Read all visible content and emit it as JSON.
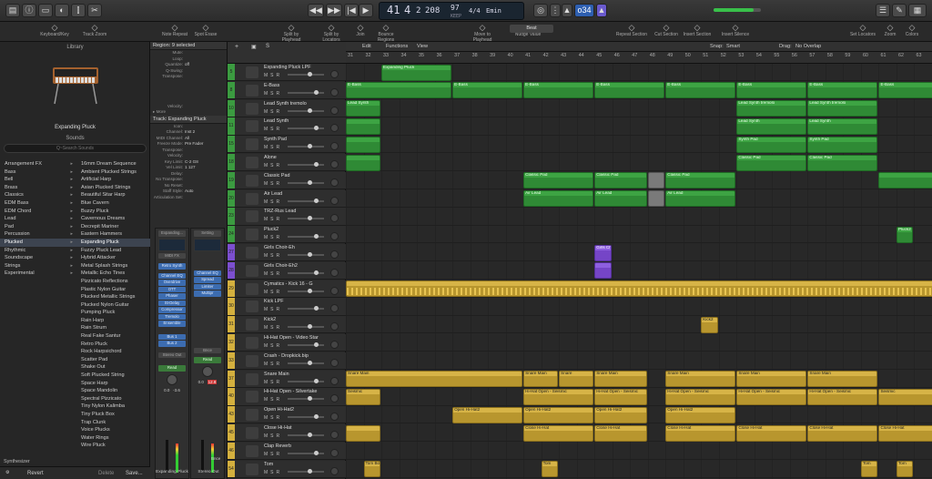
{
  "transport": {
    "bars": "41",
    "beats": "4",
    "division": "2",
    "ticks": "208",
    "tempo": "97",
    "tempo_label": "KEEP",
    "sig": "4/4",
    "key": "Emin",
    "cpu_label": "o34"
  },
  "toolbar": {
    "items": [
      "Keyboard/Key",
      "Track Zoom",
      "Note Repeat",
      "Spot Erase",
      "Split by Playhead",
      "Split by Locators",
      "Join",
      "Bounce Regions",
      "Move to Playhead",
      "Nudge Value",
      "Repeat Section",
      "Cut Section",
      "Insert Section",
      "Insert Silence",
      "Set Locators",
      "Zoom",
      "Colors"
    ],
    "beat_label": "Beat"
  },
  "library": {
    "title": "Library",
    "patch_name": "Expanding Pluck",
    "sounds_label": "Sounds",
    "search_placeholder": "Q~Search Sounds",
    "categories": [
      "Arrangement FX",
      "Bass",
      "Bell",
      "Brass",
      "Classics",
      "EDM Bass",
      "EDM Chord",
      "Lead",
      "Pad",
      "Percussion",
      "Plucked",
      "Rhythmic",
      "Soundscape",
      "Strings",
      "Experimental"
    ],
    "selected_category": "Plucked",
    "patches": [
      "16mm Dream Sequence",
      "Ambient Plucked Strings",
      "Artificial Harp",
      "Asian Plucked Strings",
      "Beautiful Sitar Harp",
      "Blue Cavern",
      "Buzzy Pluck",
      "Cavernous Dreams",
      "Decrepit Mariner",
      "Eastern Hammers",
      "Expanding Pluck",
      "Fuzzy Pluck Lead",
      "Hybrid Attacker",
      "Metal Splash Strings",
      "Metallic Echo Tines",
      "Pizzicato Reflections",
      "Plastic Nylon Guitar",
      "Plucked Metallic Strings",
      "Plucked Nylon Guitar",
      "Pumping Pluck",
      "Rain Harp",
      "Rain Strum",
      "Real Fake Santur",
      "Retro Pluck",
      "Rock Harpsichord",
      "Scatter Pad",
      "Shake Out",
      "Soft Plucked String",
      "Space Harp",
      "Space Mandolin",
      "Spectral Pizzicato",
      "Tiny Nylon Kalimba",
      "Tiny Pluck Box",
      "Trap Clunk",
      "Voice Plucks",
      "Water Rings",
      "Wire Pluck"
    ],
    "selected_patch": "Expanding Pluck",
    "footer": {
      "category": "Synthesizer",
      "revert": "Revert",
      "delete": "Delete",
      "save": "Save..."
    }
  },
  "inspector": {
    "region_header": "Region: 9 selected",
    "region_params": [
      [
        "Mute:",
        ""
      ],
      [
        "Loop:",
        ""
      ],
      [
        "Quantize:",
        "off"
      ],
      [
        "Q-Swing:",
        ""
      ],
      [
        "Transpose:",
        ""
      ],
      [
        "",
        ""
      ],
      [
        "",
        ""
      ],
      [
        "",
        ""
      ],
      [
        "",
        ""
      ],
      [
        "Velocity:",
        ""
      ]
    ],
    "more": "More",
    "track_header": "Track: Expanding Pluck",
    "track_params": [
      [
        "Icon:",
        ""
      ],
      [
        "Channel:",
        "Inst 2"
      ],
      [
        "MIDI Channel:",
        "All"
      ],
      [
        "Freeze Mode:",
        "Pre Fader"
      ],
      [
        "Transpose:",
        ""
      ],
      [
        "Velocity:",
        ""
      ],
      [
        "Key Limit:",
        "C-2 G8"
      ],
      [
        "Vel Limit:",
        "1 127"
      ],
      [
        "Delay:",
        ""
      ],
      [
        "No Transpose:",
        ""
      ],
      [
        "No Reset:",
        ""
      ],
      [
        "Staff Style:",
        "Auto"
      ],
      [
        "Articulation Set:",
        ""
      ]
    ],
    "strip1": {
      "setting": "Expanding...",
      "eq": "",
      "midi_fx": "MIDI FX",
      "instrument": "Retro Synth",
      "plugins": [
        "Channel EQ",
        "Overdrive",
        "OTT",
        "Phaser",
        "St-Delay",
        "Compressor",
        "Tremolo",
        "Ensemble"
      ],
      "sends": [
        "Bus 1",
        "Bus 2"
      ],
      "output": "Stereo Out",
      "mode": "Read",
      "vol": "0.0",
      "pan": "-3.6",
      "name": "Expanding Pluck"
    },
    "strip2": {
      "setting": "Setting",
      "plugins": [
        "Channel EQ",
        "Spread",
        "Limiter",
        "Multipr"
      ],
      "output": "Bnce",
      "mode": "Read",
      "vol": "0.0",
      "pan": "12.8",
      "name": "Stereo Out",
      "bnce": "Bnce"
    }
  },
  "arrange": {
    "menus": [
      "Edit",
      "Functions",
      "View"
    ],
    "snap_label": "Snap:",
    "snap_value": "Smart",
    "drag_label": "Drag:",
    "drag_value": "No Overlap",
    "bars": [
      "31",
      "32",
      "33",
      "34",
      "35",
      "36",
      "37",
      "38",
      "39",
      "40",
      "41",
      "42",
      "43",
      "44",
      "45",
      "46",
      "47",
      "48",
      "49",
      "50",
      "51",
      "52",
      "53",
      "54",
      "55",
      "56",
      "57",
      "58",
      "59",
      "60",
      "61",
      "62",
      "63"
    ]
  },
  "tracks": [
    {
      "n": "5",
      "name": "Expanding Pluck LPF",
      "c": "#3b9b40"
    },
    {
      "n": "8",
      "name": "E-Bass",
      "c": "#3b9b40"
    },
    {
      "n": "10",
      "name": "Lead Synth tremolo",
      "c": "#3b9b40"
    },
    {
      "n": "11",
      "name": "Lead Synth",
      "c": "#3b9b40"
    },
    {
      "n": "15",
      "name": "Synth Pad",
      "c": "#3b9b40"
    },
    {
      "n": "18",
      "name": "Alone",
      "c": "#3b9b40"
    },
    {
      "n": "19",
      "name": "Classic Pad",
      "c": "#3b9b40"
    },
    {
      "n": "20",
      "name": "Air Lead",
      "c": "#3b9b40"
    },
    {
      "n": "23",
      "name": "TRZ-Rus Lead",
      "c": "#3b9b40"
    },
    {
      "n": "24",
      "name": "Pluck2",
      "c": "#3b9b40"
    },
    {
      "n": "27",
      "name": "Girls Choir-Eh",
      "c": "#7c4fd0"
    },
    {
      "n": "28",
      "name": "Girls Choir-Eh2",
      "c": "#7c4fd0"
    },
    {
      "n": "29",
      "name": "Cymatics - Kick 16 - G",
      "c": "#d4b03e"
    },
    {
      "n": "30",
      "name": "Kick LPF",
      "c": "#d4b03e"
    },
    {
      "n": "31",
      "name": "Kick2",
      "c": "#d4b03e"
    },
    {
      "n": "32",
      "name": "Hi-Hat Open - Video Star",
      "c": "#d4b03e"
    },
    {
      "n": "33",
      "name": "Crash - Dropkick.bip",
      "c": "#d4b03e"
    },
    {
      "n": "37",
      "name": "Snare Main",
      "c": "#d4b03e"
    },
    {
      "n": "40",
      "name": "Hi-Hat Open - Silvertake",
      "c": "#d4b03e"
    },
    {
      "n": "43",
      "name": "Open Hi-Hat2",
      "c": "#d4b03e"
    },
    {
      "n": "45",
      "name": "Close Hi-Hat",
      "c": "#d4b03e"
    },
    {
      "n": "46",
      "name": "Clap Reverb",
      "c": "#d4b03e"
    },
    {
      "n": "54",
      "name": "Tom",
      "c": "#d4b03e"
    }
  ],
  "regions": [
    {
      "lane": 0,
      "b": 2,
      "e": 6,
      "t": "g",
      "l": "Expanding Pluck"
    },
    {
      "lane": 1,
      "b": 0,
      "e": 6,
      "t": "g",
      "l": "E-Bass"
    },
    {
      "lane": 1,
      "b": 6,
      "e": 10,
      "t": "g",
      "l": "E-Bass"
    },
    {
      "lane": 1,
      "b": 10,
      "e": 14,
      "t": "g",
      "l": "E-Bass"
    },
    {
      "lane": 1,
      "b": 14,
      "e": 18,
      "t": "g",
      "l": "E-Bass"
    },
    {
      "lane": 1,
      "b": 18,
      "e": 22,
      "t": "g",
      "l": "E-Bass"
    },
    {
      "lane": 1,
      "b": 22,
      "e": 26,
      "t": "g",
      "l": "E-Bass"
    },
    {
      "lane": 1,
      "b": 26,
      "e": 30,
      "t": "g",
      "l": "E-Bass"
    },
    {
      "lane": 1,
      "b": 30,
      "e": 34,
      "t": "g",
      "l": "E-Bass"
    },
    {
      "lane": 2,
      "b": 0,
      "e": 2,
      "t": "g",
      "l": "Lead Synth"
    },
    {
      "lane": 2,
      "b": 22,
      "e": 26,
      "t": "g",
      "l": "Lead Synth tremolo"
    },
    {
      "lane": 2,
      "b": 26,
      "e": 30,
      "t": "g",
      "l": "Lead Synth tremolo"
    },
    {
      "lane": 3,
      "b": 0,
      "e": 2,
      "t": "g",
      "l": ""
    },
    {
      "lane": 3,
      "b": 22,
      "e": 26,
      "t": "g",
      "l": "Lead Synth"
    },
    {
      "lane": 3,
      "b": 26,
      "e": 30,
      "t": "g",
      "l": "Lead Synth"
    },
    {
      "lane": 4,
      "b": 0,
      "e": 2,
      "t": "g",
      "l": ""
    },
    {
      "lane": 4,
      "b": 22,
      "e": 26,
      "t": "g",
      "l": "Synth Pad"
    },
    {
      "lane": 4,
      "b": 26,
      "e": 30,
      "t": "g",
      "l": "Synth Pad"
    },
    {
      "lane": 5,
      "b": 0,
      "e": 2,
      "t": "g",
      "l": ""
    },
    {
      "lane": 5,
      "b": 22,
      "e": 26,
      "t": "g",
      "l": "Classic Pad"
    },
    {
      "lane": 5,
      "b": 26,
      "e": 30,
      "t": "g",
      "l": "Classic Pad"
    },
    {
      "lane": 6,
      "b": 10,
      "e": 14,
      "t": "g",
      "l": "Classic Pad"
    },
    {
      "lane": 6,
      "b": 14,
      "e": 17,
      "t": "g",
      "l": "Classic Pad"
    },
    {
      "lane": 6,
      "b": 17,
      "e": 18,
      "t": "gr",
      "l": ""
    },
    {
      "lane": 6,
      "b": 18,
      "e": 22,
      "t": "g",
      "l": "Classic Pad"
    },
    {
      "lane": 6,
      "b": 30,
      "e": 34,
      "t": "g",
      "l": ""
    },
    {
      "lane": 7,
      "b": 10,
      "e": 14,
      "t": "g",
      "l": "Air Lead"
    },
    {
      "lane": 7,
      "b": 14,
      "e": 17,
      "t": "g",
      "l": "Air Lead"
    },
    {
      "lane": 7,
      "b": 17,
      "e": 18,
      "t": "gr",
      "l": ""
    },
    {
      "lane": 7,
      "b": 18,
      "e": 22,
      "t": "g",
      "l": "Air Lead"
    },
    {
      "lane": 9,
      "b": 31,
      "e": 32,
      "t": "g",
      "l": "Pluck2"
    },
    {
      "lane": 10,
      "b": 14,
      "e": 15,
      "t": "p",
      "l": "Girls Ch"
    },
    {
      "lane": 11,
      "b": 14,
      "e": 15,
      "t": "p",
      "l": ""
    },
    {
      "lane": 12,
      "b": 0,
      "e": 34,
      "t": "yt",
      "l": ""
    },
    {
      "lane": 14,
      "b": 20,
      "e": 21,
      "t": "y",
      "l": "Kick2"
    },
    {
      "lane": 17,
      "b": 0,
      "e": 10,
      "t": "y",
      "l": "Snare Main"
    },
    {
      "lane": 17,
      "b": 10,
      "e": 12,
      "t": "y",
      "l": "Snare Main"
    },
    {
      "lane": 17,
      "b": 12,
      "e": 14,
      "t": "y",
      "l": "Snare"
    },
    {
      "lane": 17,
      "b": 14,
      "e": 17,
      "t": "y",
      "l": "Snare Main"
    },
    {
      "lane": 17,
      "b": 18,
      "e": 22,
      "t": "y",
      "l": "Snare Main"
    },
    {
      "lane": 17,
      "b": 22,
      "e": 26,
      "t": "y",
      "l": "Snare Main"
    },
    {
      "lane": 17,
      "b": 26,
      "e": 30,
      "t": "y",
      "l": "Snare Main"
    },
    {
      "lane": 18,
      "b": 0,
      "e": 2,
      "t": "y",
      "l": "Seismic"
    },
    {
      "lane": 18,
      "b": 10,
      "e": 14,
      "t": "y",
      "l": "Hi-Hat Open - Seismic"
    },
    {
      "lane": 18,
      "b": 14,
      "e": 17,
      "t": "y",
      "l": "Hi-Hat Open - Seismic"
    },
    {
      "lane": 18,
      "b": 18,
      "e": 22,
      "t": "y",
      "l": "Hi-Hat Open - Seismic"
    },
    {
      "lane": 18,
      "b": 22,
      "e": 26,
      "t": "y",
      "l": "Hi-Hat Open - Seismic"
    },
    {
      "lane": 18,
      "b": 26,
      "e": 30,
      "t": "y",
      "l": "Hi-Hat Open - Seismic"
    },
    {
      "lane": 18,
      "b": 30,
      "e": 34,
      "t": "y",
      "l": "Seismic"
    },
    {
      "lane": 19,
      "b": 6,
      "e": 10,
      "t": "y",
      "l": "Open Hi-Hat2"
    },
    {
      "lane": 19,
      "b": 10,
      "e": 14,
      "t": "y",
      "l": "Open Hi-Hat2"
    },
    {
      "lane": 19,
      "b": 14,
      "e": 17,
      "t": "y",
      "l": "Open Hi-Hat2"
    },
    {
      "lane": 19,
      "b": 18,
      "e": 22,
      "t": "y",
      "l": "Open Hi-Hat2"
    },
    {
      "lane": 20,
      "b": 0,
      "e": 2,
      "t": "y",
      "l": ""
    },
    {
      "lane": 20,
      "b": 10,
      "e": 14,
      "t": "y",
      "l": "Close Hi-Hat"
    },
    {
      "lane": 20,
      "b": 14,
      "e": 17,
      "t": "y",
      "l": "Close Hi-Hat"
    },
    {
      "lane": 20,
      "b": 18,
      "e": 22,
      "t": "y",
      "l": "Close Hi-Hat"
    },
    {
      "lane": 20,
      "b": 22,
      "e": 26,
      "t": "y",
      "l": "Close Hi-Hat"
    },
    {
      "lane": 20,
      "b": 26,
      "e": 30,
      "t": "y",
      "l": "Close Hi-Hat"
    },
    {
      "lane": 20,
      "b": 30,
      "e": 34,
      "t": "y",
      "l": "Close Hi-Hat"
    },
    {
      "lane": 22,
      "b": 1,
      "e": 2,
      "t": "y",
      "l": "Tom Bou"
    },
    {
      "lane": 22,
      "b": 11,
      "e": 12,
      "t": "y",
      "l": "Tom"
    },
    {
      "lane": 22,
      "b": 29,
      "e": 30,
      "t": "y",
      "l": "Tom"
    },
    {
      "lane": 22,
      "b": 31,
      "e": 32,
      "t": "y",
      "l": "Tom"
    }
  ],
  "colors": {
    "green": "#2f8a35",
    "yellow": "#b8962e",
    "purple": "#7545c7",
    "record": "#e0301e"
  }
}
